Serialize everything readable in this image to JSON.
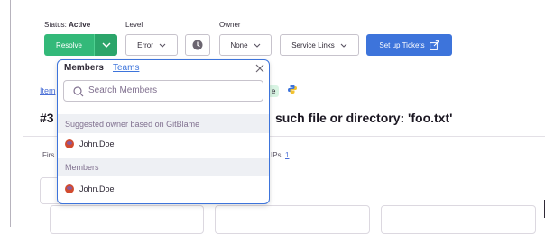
{
  "toolbar": {
    "status_prefix": "Status:",
    "status_value": "Active",
    "level_label": "Level",
    "owner_label": "Owner",
    "resolve_label": "Resolve",
    "level_value": "Error",
    "owner_value": "None",
    "service_links_label": "Service Links",
    "setup_tickets_label": "Set up Tickets"
  },
  "background": {
    "breadcrumb_text": "Item",
    "pill_text": "e",
    "issue_prefix": "#3",
    "issue_title_tail": "such file or directory: 'foo.txt'",
    "first_text": "Firs",
    "ips_label": "IPs:",
    "ips_count": "1"
  },
  "dropdown": {
    "tab_members": "Members",
    "tab_teams": "Teams",
    "search_placeholder": "Search Members",
    "suggested_header": "Suggested owner based on GitBlame",
    "suggested_user": "John.Doe",
    "members_header": "Members",
    "member_user": "John.Doe"
  },
  "colors": {
    "accent": "#3d74db",
    "resolve_green": "#33b979",
    "section_bg": "#eef0f4",
    "new_pill_bg": "#d8f4e3"
  }
}
